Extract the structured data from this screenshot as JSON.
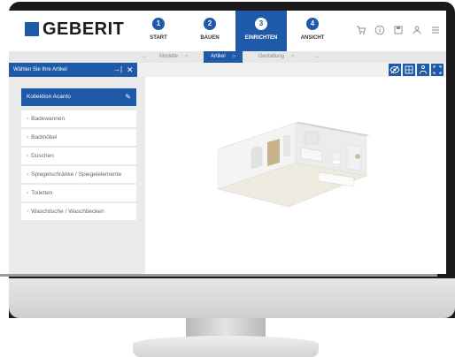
{
  "brand": {
    "name": "GEBERIT",
    "color": "#1e5aa8"
  },
  "steps": [
    {
      "num": "1",
      "label": "START"
    },
    {
      "num": "2",
      "label": "BAUEN"
    },
    {
      "num": "3",
      "label": "EINRICHTEN",
      "active": true
    },
    {
      "num": "4",
      "label": "ANSICHT"
    }
  ],
  "header_tools": [
    "cart-icon",
    "info-icon",
    "save-icon",
    "user-icon",
    "menu-icon"
  ],
  "subnav": {
    "prev_arrow": "←",
    "items": [
      {
        "label": "Modelle",
        "marker": "○"
      },
      {
        "label": "Artikel",
        "marker": "○",
        "active": true
      },
      {
        "label": "Gestaltung",
        "marker": "○"
      }
    ],
    "next_arrow": "→"
  },
  "panel": {
    "title": "Wählen Sie Ihre Artikel",
    "pin_glyph": "→|",
    "close_glyph": "✕"
  },
  "view_buttons": [
    "eye-icon",
    "floorplan-icon",
    "person-icon",
    "fullscreen-icon"
  ],
  "collection": {
    "label": "Kollektion Acanto",
    "edit_glyph": "✎"
  },
  "categories": [
    "Badewannen",
    "Badmöbel",
    "Duschen",
    "Spiegelschränke / Spiegelelemente",
    "Toiletten",
    "Waschtische / Waschbecken"
  ]
}
